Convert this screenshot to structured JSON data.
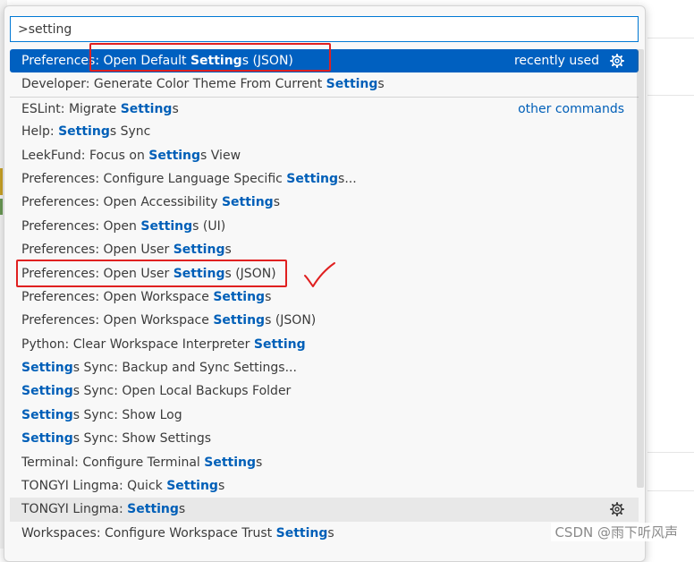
{
  "search": {
    "value": ">setting"
  },
  "rows": [
    {
      "pre": "Preferences: Open Default ",
      "hl": "Setting",
      "post": "s (JSON)",
      "right_label": "recently used",
      "selected": true,
      "gear": true
    },
    {
      "pre": "Developer: Generate Color Theme From Current ",
      "hl": "Setting",
      "post": "s"
    },
    {
      "pre": "ESLint: Migrate ",
      "hl": "Setting",
      "post": "s",
      "right_label": "other commands",
      "separator": true
    },
    {
      "pre": "Help: ",
      "hl": "Setting",
      "post": "s Sync"
    },
    {
      "pre": "LeekFund: Focus on ",
      "hl": "Setting",
      "post": "s View"
    },
    {
      "pre": "Preferences: Configure Language Specific ",
      "hl": "Setting",
      "post": "s..."
    },
    {
      "pre": "Preferences: Open Accessibility ",
      "hl": "Setting",
      "post": "s"
    },
    {
      "pre": "Preferences: Open ",
      "hl": "Setting",
      "post": "s (UI)"
    },
    {
      "pre": "Preferences: Open User ",
      "hl": "Setting",
      "post": "s"
    },
    {
      "pre": "Preferences: Open User ",
      "hl": "Setting",
      "post": "s (JSON)"
    },
    {
      "pre": "Preferences: Open Workspace ",
      "hl": "Setting",
      "post": "s"
    },
    {
      "pre": "Preferences: Open Workspace ",
      "hl": "Setting",
      "post": "s (JSON)"
    },
    {
      "pre": "Python: Clear Workspace Interpreter ",
      "hl": "Setting",
      "post": ""
    },
    {
      "pre": "",
      "hl": "Setting",
      "post": "s Sync: Backup and Sync Settings..."
    },
    {
      "pre": "",
      "hl": "Setting",
      "post": "s Sync: Open Local Backups Folder"
    },
    {
      "pre": "",
      "hl": "Setting",
      "post": "s Sync: Show Log"
    },
    {
      "pre": "",
      "hl": "Setting",
      "post": "s Sync: Show Settings"
    },
    {
      "pre": "Terminal: Configure Terminal ",
      "hl": "Setting",
      "post": "s"
    },
    {
      "pre": "TONGYI Lingma: Quick ",
      "hl": "Setting",
      "post": "s"
    },
    {
      "pre": "TONGYI Lingma: ",
      "hl": "Setting",
      "post": "s",
      "hover": true,
      "gear": true
    },
    {
      "pre": "Workspaces: Configure Workspace Trust ",
      "hl": "Setting",
      "post": "s"
    }
  ],
  "watermark": "CSDN @雨下听风声",
  "colors": {
    "accent": "#0060c0",
    "highlight": "#005fb8",
    "annotation": "#e02020"
  }
}
